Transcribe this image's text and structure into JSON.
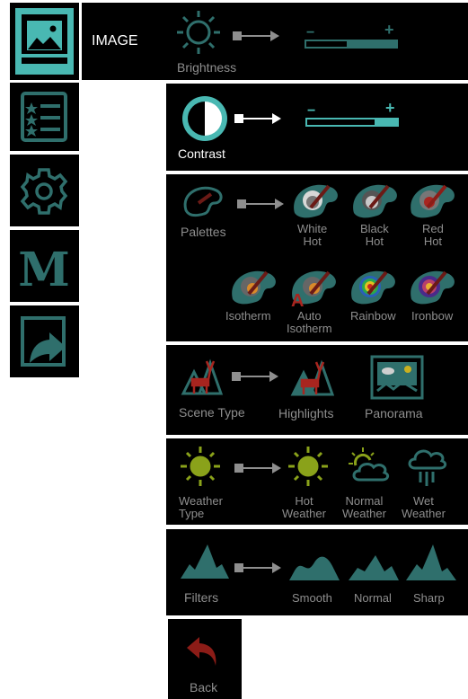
{
  "colors": {
    "teal": "#49b8b2",
    "dim_text": "#8e8e8e",
    "active_text": "#ffffff",
    "red": "#a8251f",
    "olive": "#8aa21a",
    "panel": "#000000"
  },
  "sidebar": [
    {
      "name": "image",
      "icon": "image-icon"
    },
    {
      "name": "list",
      "icon": "list-icon"
    },
    {
      "name": "settings",
      "icon": "gear-icon"
    },
    {
      "name": "mode",
      "icon": "m-icon",
      "glyph": "M"
    },
    {
      "name": "export",
      "icon": "export-icon"
    }
  ],
  "header": {
    "title": "IMAGE"
  },
  "brightness": {
    "label": "Brightness",
    "slider_level": 0.55,
    "minus": "−",
    "plus": "+"
  },
  "contrast": {
    "label": "Contrast",
    "slider_level": 0.25,
    "minus": "−",
    "plus": "+"
  },
  "palettes": {
    "label": "Palettes",
    "options": [
      {
        "line1": "White",
        "line2": "Hot"
      },
      {
        "line1": "Black",
        "line2": "Hot"
      },
      {
        "line1": "Red",
        "line2": "Hot"
      },
      {
        "line1": "Isotherm",
        "line2": ""
      },
      {
        "line1": "Auto",
        "line2": "Isotherm",
        "badge": "A"
      },
      {
        "line1": "Rainbow",
        "line2": ""
      },
      {
        "line1": "Ironbow",
        "line2": ""
      }
    ]
  },
  "scene": {
    "label": "Scene Type",
    "options": [
      "Highlights",
      "Panorama"
    ]
  },
  "weather": {
    "label_line1": "Weather",
    "label_line2": "Type",
    "options": [
      {
        "line1": "Hot",
        "line2": "Weather"
      },
      {
        "line1": "Normal",
        "line2": "Weather"
      },
      {
        "line1": "Wet",
        "line2": "Weather"
      }
    ]
  },
  "filters": {
    "label": "Filters",
    "options": [
      "Smooth",
      "Normal",
      "Sharp"
    ]
  },
  "back": {
    "label": "Back"
  }
}
